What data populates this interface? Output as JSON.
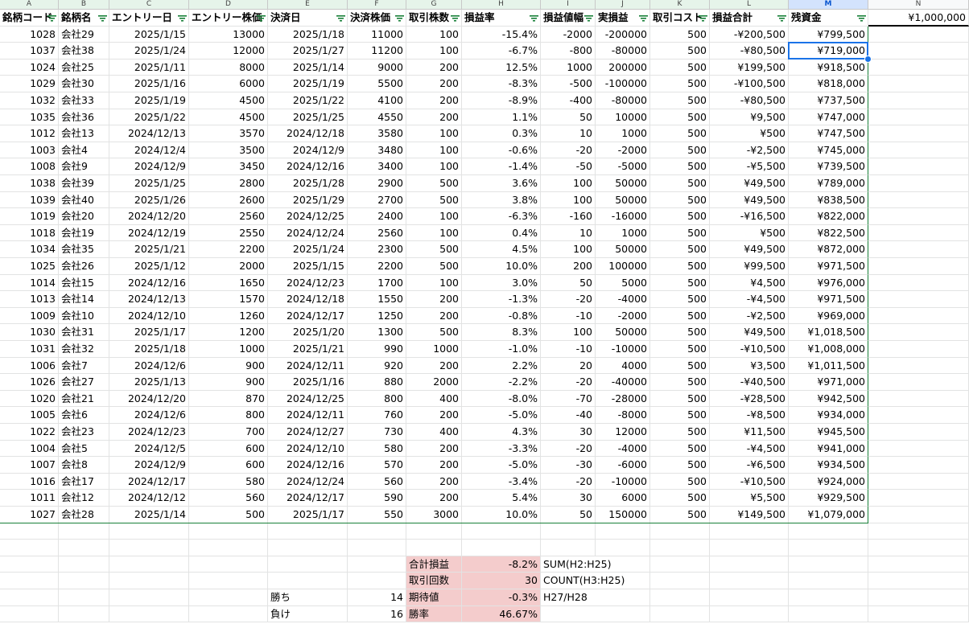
{
  "column_letters": [
    "A",
    "B",
    "C",
    "D",
    "E",
    "F",
    "G",
    "H",
    "I",
    "J",
    "K",
    "L",
    "M",
    "N"
  ],
  "headers": [
    "銘柄コード",
    "銘柄名",
    "エントリー日",
    "エントリー株価",
    "決済日",
    "決済株価",
    "取引株数",
    "損益率",
    "損益値幅",
    "実損益",
    "取引コスト",
    "損益合計",
    "残資金"
  ],
  "initial_capital": "¥1,000,000",
  "rows": [
    [
      "1028",
      "会社29",
      "2025/1/15",
      "13000",
      "2025/1/18",
      "11000",
      "100",
      "-15.4%",
      "-2000",
      "-200000",
      "500",
      "-¥200,500",
      "¥799,500"
    ],
    [
      "1037",
      "会社38",
      "2025/1/24",
      "12000",
      "2025/1/27",
      "11200",
      "100",
      "-6.7%",
      "-800",
      "-80000",
      "500",
      "-¥80,500",
      "¥719,000"
    ],
    [
      "1024",
      "会社25",
      "2025/1/11",
      "8000",
      "2025/1/14",
      "9000",
      "200",
      "12.5%",
      "1000",
      "200000",
      "500",
      "¥199,500",
      "¥918,500"
    ],
    [
      "1029",
      "会社30",
      "2025/1/16",
      "6000",
      "2025/1/19",
      "5500",
      "200",
      "-8.3%",
      "-500",
      "-100000",
      "500",
      "-¥100,500",
      "¥818,000"
    ],
    [
      "1032",
      "会社33",
      "2025/1/19",
      "4500",
      "2025/1/22",
      "4100",
      "200",
      "-8.9%",
      "-400",
      "-80000",
      "500",
      "-¥80,500",
      "¥737,500"
    ],
    [
      "1035",
      "会社36",
      "2025/1/22",
      "4500",
      "2025/1/25",
      "4550",
      "200",
      "1.1%",
      "50",
      "10000",
      "500",
      "¥9,500",
      "¥747,000"
    ],
    [
      "1012",
      "会社13",
      "2024/12/13",
      "3570",
      "2024/12/18",
      "3580",
      "100",
      "0.3%",
      "10",
      "1000",
      "500",
      "¥500",
      "¥747,500"
    ],
    [
      "1003",
      "会社4",
      "2024/12/4",
      "3500",
      "2024/12/9",
      "3480",
      "100",
      "-0.6%",
      "-20",
      "-2000",
      "500",
      "-¥2,500",
      "¥745,000"
    ],
    [
      "1008",
      "会社9",
      "2024/12/9",
      "3450",
      "2024/12/16",
      "3400",
      "100",
      "-1.4%",
      "-50",
      "-5000",
      "500",
      "-¥5,500",
      "¥739,500"
    ],
    [
      "1038",
      "会社39",
      "2025/1/25",
      "2800",
      "2025/1/28",
      "2900",
      "500",
      "3.6%",
      "100",
      "50000",
      "500",
      "¥49,500",
      "¥789,000"
    ],
    [
      "1039",
      "会社40",
      "2025/1/26",
      "2600",
      "2025/1/29",
      "2700",
      "500",
      "3.8%",
      "100",
      "50000",
      "500",
      "¥49,500",
      "¥838,500"
    ],
    [
      "1019",
      "会社20",
      "2024/12/20",
      "2560",
      "2024/12/25",
      "2400",
      "100",
      "-6.3%",
      "-160",
      "-16000",
      "500",
      "-¥16,500",
      "¥822,000"
    ],
    [
      "1018",
      "会社19",
      "2024/12/19",
      "2550",
      "2024/12/24",
      "2560",
      "100",
      "0.4%",
      "10",
      "1000",
      "500",
      "¥500",
      "¥822,500"
    ],
    [
      "1034",
      "会社35",
      "2025/1/21",
      "2200",
      "2025/1/24",
      "2300",
      "500",
      "4.5%",
      "100",
      "50000",
      "500",
      "¥49,500",
      "¥872,000"
    ],
    [
      "1025",
      "会社26",
      "2025/1/12",
      "2000",
      "2025/1/15",
      "2200",
      "500",
      "10.0%",
      "200",
      "100000",
      "500",
      "¥99,500",
      "¥971,500"
    ],
    [
      "1014",
      "会社15",
      "2024/12/16",
      "1650",
      "2024/12/23",
      "1700",
      "100",
      "3.0%",
      "50",
      "5000",
      "500",
      "¥4,500",
      "¥976,000"
    ],
    [
      "1013",
      "会社14",
      "2024/12/13",
      "1570",
      "2024/12/18",
      "1550",
      "200",
      "-1.3%",
      "-20",
      "-4000",
      "500",
      "-¥4,500",
      "¥971,500"
    ],
    [
      "1009",
      "会社10",
      "2024/12/10",
      "1260",
      "2024/12/17",
      "1250",
      "200",
      "-0.8%",
      "-10",
      "-2000",
      "500",
      "-¥2,500",
      "¥969,000"
    ],
    [
      "1030",
      "会社31",
      "2025/1/17",
      "1200",
      "2025/1/20",
      "1300",
      "500",
      "8.3%",
      "100",
      "50000",
      "500",
      "¥49,500",
      "¥1,018,500"
    ],
    [
      "1031",
      "会社32",
      "2025/1/18",
      "1000",
      "2025/1/21",
      "990",
      "1000",
      "-1.0%",
      "-10",
      "-10000",
      "500",
      "-¥10,500",
      "¥1,008,000"
    ],
    [
      "1006",
      "会社7",
      "2024/12/6",
      "900",
      "2024/12/11",
      "920",
      "200",
      "2.2%",
      "20",
      "4000",
      "500",
      "¥3,500",
      "¥1,011,500"
    ],
    [
      "1026",
      "会社27",
      "2025/1/13",
      "900",
      "2025/1/16",
      "880",
      "2000",
      "-2.2%",
      "-20",
      "-40000",
      "500",
      "-¥40,500",
      "¥971,000"
    ],
    [
      "1020",
      "会社21",
      "2024/12/20",
      "870",
      "2024/12/25",
      "800",
      "400",
      "-8.0%",
      "-70",
      "-28000",
      "500",
      "-¥28,500",
      "¥942,500"
    ],
    [
      "1005",
      "会社6",
      "2024/12/6",
      "800",
      "2024/12/11",
      "760",
      "200",
      "-5.0%",
      "-40",
      "-8000",
      "500",
      "-¥8,500",
      "¥934,000"
    ],
    [
      "1022",
      "会社23",
      "2024/12/23",
      "700",
      "2024/12/27",
      "730",
      "400",
      "4.3%",
      "30",
      "12000",
      "500",
      "¥11,500",
      "¥945,500"
    ],
    [
      "1004",
      "会社5",
      "2024/12/5",
      "600",
      "2024/12/10",
      "580",
      "200",
      "-3.3%",
      "-20",
      "-4000",
      "500",
      "-¥4,500",
      "¥941,000"
    ],
    [
      "1007",
      "会社8",
      "2024/12/9",
      "600",
      "2024/12/16",
      "570",
      "200",
      "-5.0%",
      "-30",
      "-6000",
      "500",
      "-¥6,500",
      "¥934,500"
    ],
    [
      "1016",
      "会社17",
      "2024/12/17",
      "580",
      "2024/12/24",
      "560",
      "200",
      "-3.4%",
      "-20",
      "-10000",
      "500",
      "-¥10,500",
      "¥924,000"
    ],
    [
      "1011",
      "会社12",
      "2024/12/12",
      "560",
      "2024/12/17",
      "590",
      "200",
      "5.4%",
      "30",
      "6000",
      "500",
      "¥5,500",
      "¥929,500"
    ],
    [
      "1027",
      "会社28",
      "2025/1/14",
      "500",
      "2025/1/17",
      "550",
      "3000",
      "10.0%",
      "50",
      "150000",
      "500",
      "¥149,500",
      "¥1,079,000"
    ]
  ],
  "summary": [
    {
      "label": "合計損益",
      "value": "-8.2%",
      "formula": "SUM(H2:H25)"
    },
    {
      "label": "取引回数",
      "value": "30",
      "formula": "COUNT(H3:H25)"
    },
    {
      "label": "期待値",
      "value": "-0.3%",
      "formula": "H27/H28"
    },
    {
      "label": "勝率",
      "value": "46.67%",
      "formula": ""
    }
  ],
  "win_loss": [
    {
      "label": "勝ち",
      "value": "14"
    },
    {
      "label": "負け",
      "value": "16"
    }
  ],
  "colors": {
    "header_green": "#e6f4ea",
    "summary_pink": "#f4cccc",
    "selection": "#1a73e8",
    "grid": "#e2e3e3"
  }
}
